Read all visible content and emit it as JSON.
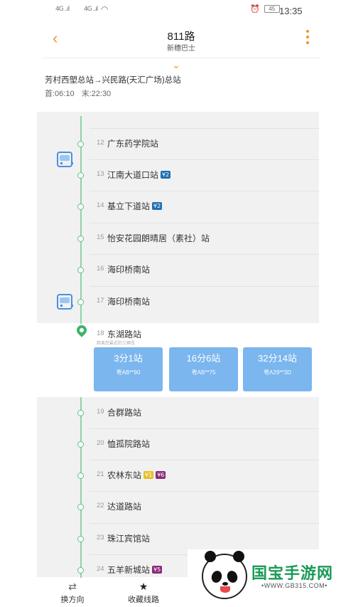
{
  "status_bar": {
    "signal_left": "4G ..ıl",
    "signal_mid": "4G ..ıl",
    "wifi_glyph": "◠",
    "battery": "45",
    "time": "13:35"
  },
  "header": {
    "title": "811路",
    "subtitle": "新穗巴士",
    "back_glyph": "‹",
    "expand_glyph": "⌄"
  },
  "route": {
    "direction": "芳村西塱总站→兴民路(天汇广场)总站",
    "first_bus": "首:06:10",
    "last_bus": "末:22:30"
  },
  "stations_top": [
    {
      "num": "12",
      "name": "广东药学院站",
      "badges": [],
      "bus": true
    },
    {
      "num": "13",
      "name": "江南大道口站",
      "badges": [
        {
          "text": "¥2",
          "color": "#1f6fb2"
        }
      ],
      "bus": false
    },
    {
      "num": "14",
      "name": "基立下道站",
      "badges": [
        {
          "text": "¥2",
          "color": "#1f6fb2"
        }
      ],
      "bus": false
    },
    {
      "num": "15",
      "name": "怡安花园朗晴居（素社）站",
      "badges": [],
      "bus": false
    },
    {
      "num": "16",
      "name": "海印桥南站",
      "badges": [],
      "bus": false
    },
    {
      "num": "17",
      "name": "海印桥南站",
      "badges": [],
      "bus": true
    }
  ],
  "current_station": {
    "num": "18",
    "name": "东湖路站",
    "note": "距离您最近的三辆车",
    "arrivals": [
      {
        "time": "3分1站",
        "plate": "粤AB**90"
      },
      {
        "time": "16分6站",
        "plate": "粤AB**75"
      },
      {
        "time": "32分14站",
        "plate": "粤A29**3D"
      }
    ]
  },
  "stations_bottom": [
    {
      "num": "19",
      "name": "合群路站",
      "badges": []
    },
    {
      "num": "20",
      "name": "恤孤院路站",
      "badges": []
    },
    {
      "num": "21",
      "name": "农林东站",
      "badges": [
        {
          "text": "¥1",
          "color": "#e6c02a"
        },
        {
          "text": "¥6",
          "color": "#8a2a7a"
        }
      ]
    },
    {
      "num": "22",
      "name": "达道路站",
      "badges": []
    },
    {
      "num": "23",
      "name": "珠江宾馆站",
      "badges": []
    },
    {
      "num": "24",
      "name": "五羊新城站",
      "badges": [
        {
          "text": "¥5",
          "color": "#8a2a7a"
        }
      ]
    }
  ],
  "bottom_bar": {
    "switch_label": "换方向",
    "switch_glyph": "⇄",
    "favorite_label": "收藏线路",
    "favorite_glyph": "★"
  },
  "watermark": {
    "name": "国宝手游网",
    "url": "•WWW.GB315.COM•"
  },
  "colors": {
    "accent": "#f0922b",
    "line": "#8fd3a4",
    "dot": "#5fc17d",
    "arrival_card": "#7bb6ee"
  }
}
